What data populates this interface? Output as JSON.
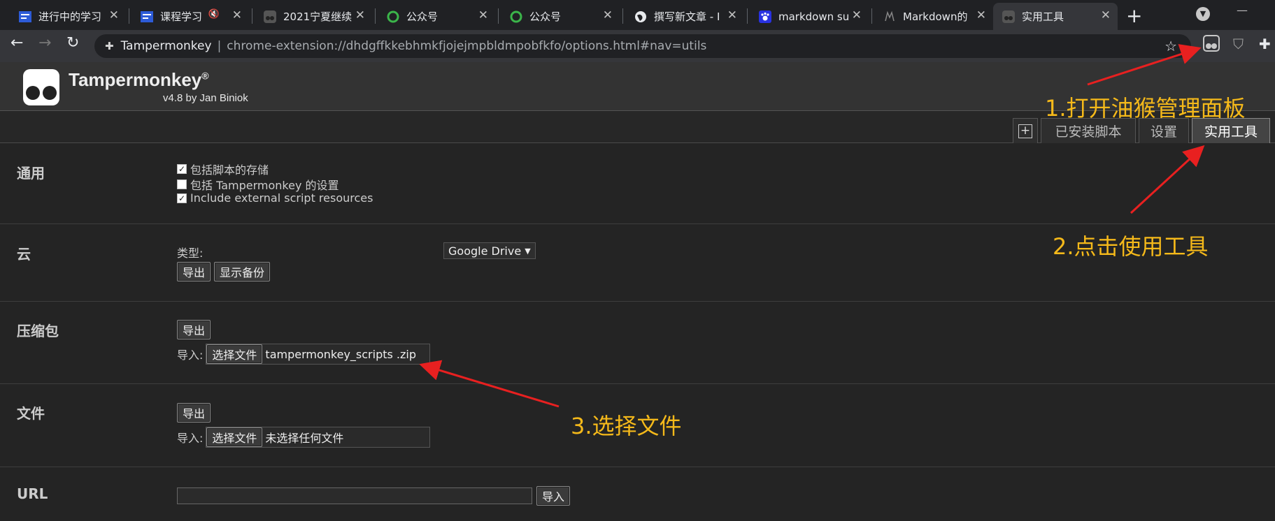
{
  "browser": {
    "tabs": [
      {
        "title": "进行中的学习",
        "icon": "blue-doc-icon",
        "muted": false,
        "active": false
      },
      {
        "title": "课程学习",
        "icon": "blue-doc-icon",
        "muted": true,
        "active": false
      },
      {
        "title": "2021宁夏继续",
        "icon": "dark-app-icon",
        "muted": false,
        "active": false
      },
      {
        "title": "公众号",
        "icon": "wechat-icon",
        "muted": false,
        "active": false
      },
      {
        "title": "公众号",
        "icon": "wechat-icon",
        "muted": false,
        "active": false
      },
      {
        "title": "撰写新文章 - I",
        "icon": "globe-icon",
        "muted": false,
        "active": false
      },
      {
        "title": "markdown su",
        "icon": "baidu-paw-icon",
        "muted": false,
        "active": false
      },
      {
        "title": "Markdown的",
        "icon": "github-icon",
        "muted": false,
        "active": false
      },
      {
        "title": "实用工具",
        "icon": "tampermonkey-icon",
        "muted": false,
        "active": true
      }
    ],
    "omnibox": {
      "site": "Tampermonkey",
      "url": "chrome-extension://dhdgffkkebhmkfjojejmpbldmpobfkfo/options.html#nav=utils"
    }
  },
  "tm": {
    "name": "Tampermonkey",
    "reg": "®",
    "version": "v4.8 by Jan Biniok",
    "tabs": {
      "installed": "已安装脚本",
      "settings": "设置",
      "utils": "实用工具"
    }
  },
  "sections": {
    "general": {
      "label": "通用",
      "options": [
        {
          "label": "包括脚本的存储",
          "checked": true
        },
        {
          "label": "包括 Tampermonkey 的设置",
          "checked": false
        },
        {
          "label": "Include external script resources",
          "checked": true
        }
      ]
    },
    "cloud": {
      "label": "云",
      "type_label": "类型:",
      "type_value": "Google Drive",
      "export": "导出",
      "show_backup": "显示备份"
    },
    "zip": {
      "label": "压缩包",
      "export": "导出",
      "import_label": "导入:",
      "choose": "选择文件",
      "filename": "tampermonkey_scripts .zip"
    },
    "file": {
      "label": "文件",
      "export": "导出",
      "import_label": "导入:",
      "choose": "选择文件",
      "filename": "未选择任何文件"
    },
    "url": {
      "label": "URL",
      "import": "导入"
    }
  },
  "annotations": {
    "step1": "1.打开油猴管理面板",
    "step2": "2.点击使用工具",
    "step3": "3.选择文件",
    "color": "#f5b91a",
    "arrow_color": "#e82020"
  }
}
